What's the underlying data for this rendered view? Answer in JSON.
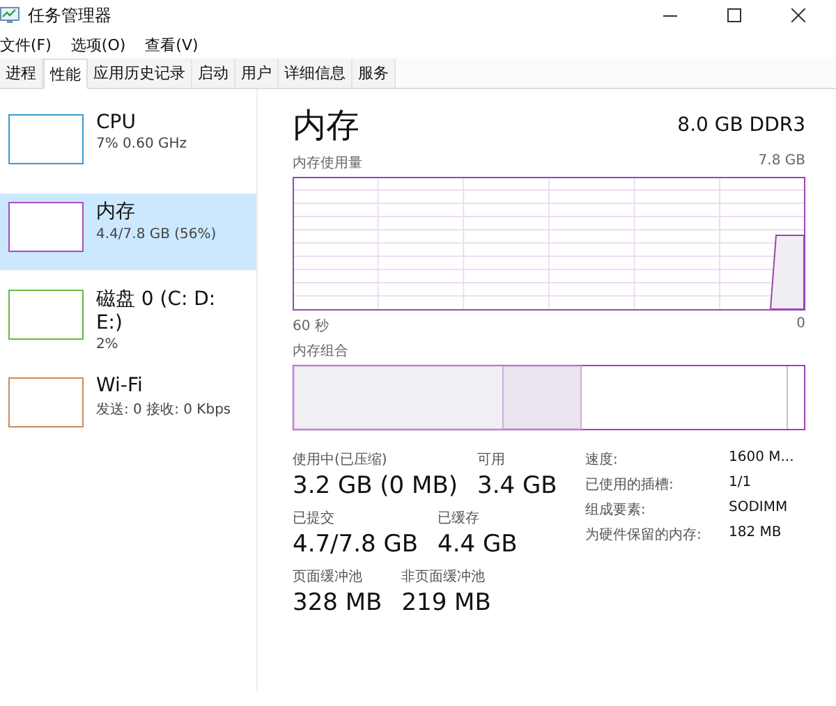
{
  "window": {
    "title": "任务管理器"
  },
  "menu": [
    "文件(F)",
    "选项(O)",
    "查看(V)"
  ],
  "tabs": [
    {
      "label": "进程",
      "selected": false
    },
    {
      "label": "性能",
      "selected": true
    },
    {
      "label": "应用历史记录",
      "selected": false
    },
    {
      "label": "启动",
      "selected": false
    },
    {
      "label": "用户",
      "selected": false
    },
    {
      "label": "详细信息",
      "selected": false
    },
    {
      "label": "服务",
      "selected": false
    }
  ],
  "sidebar": {
    "items": [
      {
        "name": "CPU",
        "detail": "7% 0.60 GHz",
        "color": "#3c9ad6",
        "selected": false
      },
      {
        "name": "内存",
        "detail": "4.4/7.8 GB (56%)",
        "color": "#a54dc9",
        "selected": true
      },
      {
        "name": "磁盘 0 (C: D: E:)",
        "detail": "2%",
        "color": "#6ab745",
        "selected": false
      },
      {
        "name": "Wi-Fi",
        "detail": "发送: 0 接收: 0 Kbps",
        "color": "#c98a5c",
        "selected": false
      }
    ]
  },
  "panel": {
    "title": "内存",
    "spec": "8.0 GB DDR3",
    "usage_label": "内存使用量",
    "usage_max": "7.8 GB",
    "time_start": "60 秒",
    "time_end": "0",
    "composition_label": "内存组合",
    "stats": [
      {
        "label": "使用中(已压缩)",
        "value": "3.2 GB (0 MB)"
      },
      {
        "label": "可用",
        "value": "3.4 GB"
      },
      {
        "label": "已提交",
        "value": "4.7/7.8 GB"
      },
      {
        "label": "已缓存",
        "value": "4.4 GB"
      },
      {
        "label": "页面缓冲池",
        "value": "328 MB"
      },
      {
        "label": "非页面缓冲池",
        "value": "219 MB"
      }
    ],
    "details": [
      {
        "key": "速度:",
        "value": "1600 M..."
      },
      {
        "key": "已使用的插槽:",
        "value": "1/1"
      },
      {
        "key": "组成要素:",
        "value": "SODIMM"
      },
      {
        "key": "为硬件保留的内存:",
        "value": "182 MB"
      }
    ]
  }
}
